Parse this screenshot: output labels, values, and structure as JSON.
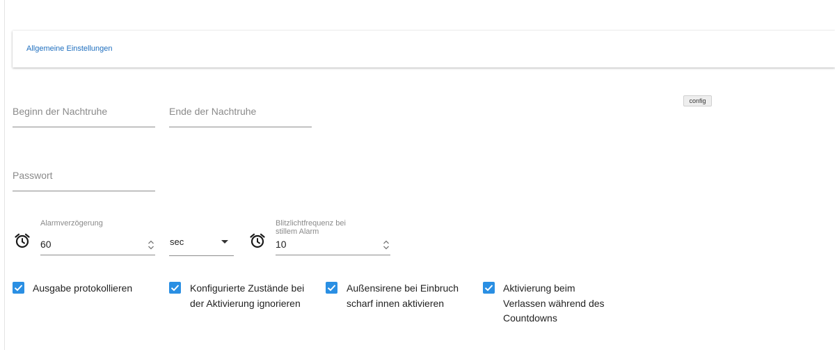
{
  "tab": {
    "label": "Allgemeine Einstellungen"
  },
  "config_button": {
    "label": "config"
  },
  "fields": {
    "night_start": {
      "placeholder": "Beginn der Nachtruhe"
    },
    "night_end": {
      "placeholder": "Ende der Nachtruhe"
    },
    "password": {
      "placeholder": "Passwort"
    }
  },
  "alarm_delay": {
    "label": "Alarmverzögerung",
    "value": "60",
    "icon": "alarm-clock-icon"
  },
  "unit_select": {
    "value": "sec"
  },
  "flash_frequency": {
    "label_line1": "Blitzlichtfrequenz bei",
    "label_line2": "stillem Alarm",
    "value": "10",
    "icon": "alarm-clock-icon"
  },
  "checkboxes": [
    {
      "checked": true,
      "lines": [
        "Ausgabe protokollieren"
      ]
    },
    {
      "checked": true,
      "lines": [
        "Konfigurierte Zustände bei",
        "der Aktivierung ignorieren"
      ]
    },
    {
      "checked": true,
      "lines": [
        "Außensirene bei Einbruch",
        "scharf innen aktivieren"
      ]
    },
    {
      "checked": true,
      "lines": [
        "Aktivierung beim",
        "Verlassen während des",
        "Countdowns"
      ]
    }
  ],
  "colors": {
    "accent": "#2a8fe3",
    "link": "#1f6fbf"
  }
}
